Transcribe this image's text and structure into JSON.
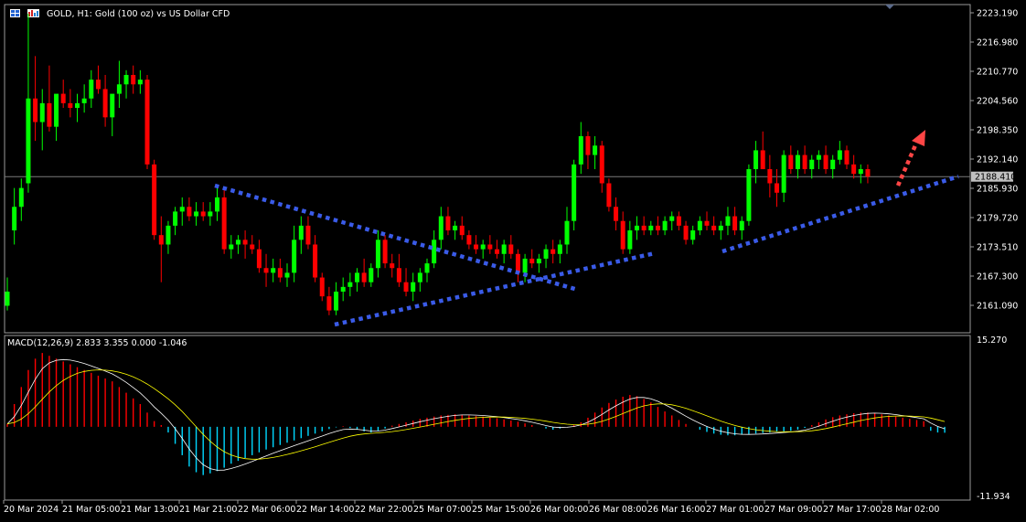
{
  "header": {
    "title": "GOLD, H1:  Gold (100 oz) vs US Dollar CFD",
    "icon": "window-tiles-icon"
  },
  "price_axis": {
    "labels": [
      "2223.190",
      "2216.980",
      "2210.770",
      "2204.560",
      "2198.350",
      "2192.140",
      "2185.930",
      "2179.720",
      "2173.510",
      "2167.300",
      "2161.090"
    ],
    "current_price": "2188.410"
  },
  "macd": {
    "label": "MACD(12,26,9) 2.833 3.355 0.000 -1.046",
    "axis_max": "15.270",
    "axis_min": "-11.934"
  },
  "time_axis": {
    "labels": [
      "20 Mar 2024",
      "21 Mar 05:00",
      "21 Mar 13:00",
      "21 Mar 21:00",
      "22 Mar 06:00",
      "22 Mar 14:00",
      "22 Mar 22:00",
      "25 Mar 07:00",
      "25 Mar 15:00",
      "26 Mar 00:00",
      "26 Mar 08:00",
      "26 Mar 16:00",
      "27 Mar 01:00",
      "27 Mar 09:00",
      "27 Mar 17:00",
      "28 Mar 02:00"
    ]
  },
  "colors": {
    "bull": "#00ff00",
    "bear": "#ff0000",
    "trend": "#3a5be8",
    "arrow": "#ff4040",
    "macd_pos": "#ff0000",
    "macd_neg": "#00d8ff",
    "macd_line": "#ffffff",
    "signal_line": "#ffff00"
  },
  "chart_data": {
    "type": "candlestick",
    "symbol": "GOLD",
    "timeframe": "H1",
    "y_range": [
      2157.3,
      2226.0
    ],
    "candles": [
      {
        "o": 2161,
        "h": 2167,
        "l": 2160,
        "c": 2164
      },
      {
        "o": 2177,
        "h": 2186,
        "l": 2174,
        "c": 2182
      },
      {
        "o": 2182,
        "h": 2188,
        "l": 2179,
        "c": 2186
      },
      {
        "o": 2187,
        "h": 2223,
        "l": 2185,
        "c": 2205
      },
      {
        "o": 2205,
        "h": 2214,
        "l": 2196,
        "c": 2200
      },
      {
        "o": 2200,
        "h": 2207,
        "l": 2194,
        "c": 2204
      },
      {
        "o": 2204,
        "h": 2212,
        "l": 2198,
        "c": 2199
      },
      {
        "o": 2199,
        "h": 2205,
        "l": 2196,
        "c": 2206
      },
      {
        "o": 2206,
        "h": 2209,
        "l": 2203,
        "c": 2204
      },
      {
        "o": 2204,
        "h": 2207,
        "l": 2201,
        "c": 2203
      },
      {
        "o": 2203,
        "h": 2206,
        "l": 2200,
        "c": 2204
      },
      {
        "o": 2204,
        "h": 2208,
        "l": 2202,
        "c": 2205
      },
      {
        "o": 2205,
        "h": 2211,
        "l": 2203,
        "c": 2209
      },
      {
        "o": 2209,
        "h": 2212,
        "l": 2206,
        "c": 2207
      },
      {
        "o": 2207,
        "h": 2210,
        "l": 2199,
        "c": 2201
      },
      {
        "o": 2201,
        "h": 2205,
        "l": 2197,
        "c": 2206
      },
      {
        "o": 2206,
        "h": 2213,
        "l": 2203,
        "c": 2208
      },
      {
        "o": 2208,
        "h": 2211,
        "l": 2205,
        "c": 2210
      },
      {
        "o": 2210,
        "h": 2212,
        "l": 2206,
        "c": 2208
      },
      {
        "o": 2208,
        "h": 2211,
        "l": 2206,
        "c": 2209
      },
      {
        "o": 2209,
        "h": 2210,
        "l": 2190,
        "c": 2191
      },
      {
        "o": 2191,
        "h": 2192,
        "l": 2175,
        "c": 2176
      },
      {
        "o": 2176,
        "h": 2180,
        "l": 2166,
        "c": 2174
      },
      {
        "o": 2174,
        "h": 2179,
        "l": 2172,
        "c": 2178
      },
      {
        "o": 2178,
        "h": 2182,
        "l": 2176,
        "c": 2181
      },
      {
        "o": 2181,
        "h": 2184,
        "l": 2178,
        "c": 2182
      },
      {
        "o": 2182,
        "h": 2184,
        "l": 2179,
        "c": 2180
      },
      {
        "o": 2180,
        "h": 2183,
        "l": 2178,
        "c": 2181
      },
      {
        "o": 2181,
        "h": 2183,
        "l": 2179,
        "c": 2180
      },
      {
        "o": 2180,
        "h": 2183,
        "l": 2178,
        "c": 2181
      },
      {
        "o": 2181,
        "h": 2186,
        "l": 2179,
        "c": 2184
      },
      {
        "o": 2184,
        "h": 2186,
        "l": 2172,
        "c": 2173
      },
      {
        "o": 2173,
        "h": 2176,
        "l": 2171,
        "c": 2174
      },
      {
        "o": 2174,
        "h": 2176,
        "l": 2172,
        "c": 2175
      },
      {
        "o": 2175,
        "h": 2177,
        "l": 2171,
        "c": 2174
      },
      {
        "o": 2174,
        "h": 2176,
        "l": 2172,
        "c": 2173
      },
      {
        "o": 2173,
        "h": 2175,
        "l": 2168,
        "c": 2169
      },
      {
        "o": 2169,
        "h": 2172,
        "l": 2165,
        "c": 2168
      },
      {
        "o": 2168,
        "h": 2171,
        "l": 2166,
        "c": 2169
      },
      {
        "o": 2169,
        "h": 2171,
        "l": 2166,
        "c": 2167
      },
      {
        "o": 2167,
        "h": 2170,
        "l": 2165,
        "c": 2168
      },
      {
        "o": 2168,
        "h": 2178,
        "l": 2166,
        "c": 2175
      },
      {
        "o": 2175,
        "h": 2180,
        "l": 2172,
        "c": 2178
      },
      {
        "o": 2178,
        "h": 2180,
        "l": 2173,
        "c": 2174
      },
      {
        "o": 2174,
        "h": 2176,
        "l": 2166,
        "c": 2167
      },
      {
        "o": 2167,
        "h": 2168,
        "l": 2162,
        "c": 2163
      },
      {
        "o": 2163,
        "h": 2165,
        "l": 2159,
        "c": 2160
      },
      {
        "o": 2160,
        "h": 2166,
        "l": 2159,
        "c": 2164
      },
      {
        "o": 2164,
        "h": 2167,
        "l": 2162,
        "c": 2165
      },
      {
        "o": 2165,
        "h": 2168,
        "l": 2163,
        "c": 2166
      },
      {
        "o": 2166,
        "h": 2169,
        "l": 2164,
        "c": 2168
      },
      {
        "o": 2168,
        "h": 2171,
        "l": 2165,
        "c": 2166
      },
      {
        "o": 2166,
        "h": 2170,
        "l": 2165,
        "c": 2169
      },
      {
        "o": 2169,
        "h": 2177,
        "l": 2167,
        "c": 2175
      },
      {
        "o": 2175,
        "h": 2176,
        "l": 2169,
        "c": 2170
      },
      {
        "o": 2170,
        "h": 2172,
        "l": 2167,
        "c": 2169
      },
      {
        "o": 2169,
        "h": 2172,
        "l": 2165,
        "c": 2166
      },
      {
        "o": 2166,
        "h": 2169,
        "l": 2163,
        "c": 2164
      },
      {
        "o": 2164,
        "h": 2168,
        "l": 2162,
        "c": 2166
      },
      {
        "o": 2166,
        "h": 2169,
        "l": 2164,
        "c": 2168
      },
      {
        "o": 2168,
        "h": 2171,
        "l": 2166,
        "c": 2170
      },
      {
        "o": 2170,
        "h": 2177,
        "l": 2169,
        "c": 2175
      },
      {
        "o": 2175,
        "h": 2182,
        "l": 2173,
        "c": 2180
      },
      {
        "o": 2180,
        "h": 2182,
        "l": 2176,
        "c": 2177
      },
      {
        "o": 2177,
        "h": 2179,
        "l": 2175,
        "c": 2178
      },
      {
        "o": 2178,
        "h": 2180,
        "l": 2175,
        "c": 2176
      },
      {
        "o": 2176,
        "h": 2177,
        "l": 2173,
        "c": 2174
      },
      {
        "o": 2174,
        "h": 2176,
        "l": 2172,
        "c": 2173
      },
      {
        "o": 2173,
        "h": 2175,
        "l": 2171,
        "c": 2174
      },
      {
        "o": 2174,
        "h": 2176,
        "l": 2172,
        "c": 2173
      },
      {
        "o": 2173,
        "h": 2175,
        "l": 2171,
        "c": 2172
      },
      {
        "o": 2172,
        "h": 2175,
        "l": 2170,
        "c": 2174
      },
      {
        "o": 2174,
        "h": 2176,
        "l": 2171,
        "c": 2172
      },
      {
        "o": 2172,
        "h": 2173,
        "l": 2166,
        "c": 2168
      },
      {
        "o": 2168,
        "h": 2172,
        "l": 2166,
        "c": 2171
      },
      {
        "o": 2171,
        "h": 2173,
        "l": 2169,
        "c": 2170
      },
      {
        "o": 2170,
        "h": 2172,
        "l": 2168,
        "c": 2171
      },
      {
        "o": 2171,
        "h": 2174,
        "l": 2169,
        "c": 2173
      },
      {
        "o": 2173,
        "h": 2175,
        "l": 2170,
        "c": 2172
      },
      {
        "o": 2172,
        "h": 2175,
        "l": 2170,
        "c": 2174
      },
      {
        "o": 2174,
        "h": 2182,
        "l": 2172,
        "c": 2179
      },
      {
        "o": 2179,
        "h": 2192,
        "l": 2177,
        "c": 2191
      },
      {
        "o": 2191,
        "h": 2200,
        "l": 2189,
        "c": 2197
      },
      {
        "o": 2197,
        "h": 2198,
        "l": 2190,
        "c": 2193
      },
      {
        "o": 2193,
        "h": 2197,
        "l": 2190,
        "c": 2195
      },
      {
        "o": 2195,
        "h": 2196,
        "l": 2185,
        "c": 2187
      },
      {
        "o": 2187,
        "h": 2188,
        "l": 2181,
        "c": 2182
      },
      {
        "o": 2182,
        "h": 2184,
        "l": 2177,
        "c": 2179
      },
      {
        "o": 2179,
        "h": 2181,
        "l": 2172,
        "c": 2173
      },
      {
        "o": 2173,
        "h": 2179,
        "l": 2172,
        "c": 2177
      },
      {
        "o": 2177,
        "h": 2180,
        "l": 2175,
        "c": 2178
      },
      {
        "o": 2178,
        "h": 2180,
        "l": 2176,
        "c": 2177
      },
      {
        "o": 2177,
        "h": 2179,
        "l": 2176,
        "c": 2178
      },
      {
        "o": 2178,
        "h": 2180,
        "l": 2176,
        "c": 2177
      },
      {
        "o": 2177,
        "h": 2180,
        "l": 2176,
        "c": 2179
      },
      {
        "o": 2179,
        "h": 2181,
        "l": 2177,
        "c": 2180
      },
      {
        "o": 2180,
        "h": 2181,
        "l": 2177,
        "c": 2178
      },
      {
        "o": 2178,
        "h": 2179,
        "l": 2174,
        "c": 2175
      },
      {
        "o": 2175,
        "h": 2178,
        "l": 2174,
        "c": 2177
      },
      {
        "o": 2177,
        "h": 2180,
        "l": 2176,
        "c": 2179
      },
      {
        "o": 2179,
        "h": 2181,
        "l": 2177,
        "c": 2178
      },
      {
        "o": 2178,
        "h": 2180,
        "l": 2176,
        "c": 2177
      },
      {
        "o": 2177,
        "h": 2179,
        "l": 2175,
        "c": 2178
      },
      {
        "o": 2178,
        "h": 2182,
        "l": 2176,
        "c": 2180
      },
      {
        "o": 2180,
        "h": 2182,
        "l": 2176,
        "c": 2177
      },
      {
        "o": 2177,
        "h": 2180,
        "l": 2175,
        "c": 2179
      },
      {
        "o": 2179,
        "h": 2191,
        "l": 2178,
        "c": 2190
      },
      {
        "o": 2190,
        "h": 2196,
        "l": 2187,
        "c": 2194
      },
      {
        "o": 2194,
        "h": 2198,
        "l": 2190,
        "c": 2190
      },
      {
        "o": 2190,
        "h": 2193,
        "l": 2184,
        "c": 2187
      },
      {
        "o": 2187,
        "h": 2190,
        "l": 2182,
        "c": 2185
      },
      {
        "o": 2185,
        "h": 2194,
        "l": 2183,
        "c": 2193
      },
      {
        "o": 2193,
        "h": 2195,
        "l": 2189,
        "c": 2190
      },
      {
        "o": 2190,
        "h": 2194,
        "l": 2188,
        "c": 2193
      },
      {
        "o": 2193,
        "h": 2195,
        "l": 2189,
        "c": 2190
      },
      {
        "o": 2190,
        "h": 2193,
        "l": 2188,
        "c": 2192
      },
      {
        "o": 2192,
        "h": 2194,
        "l": 2190,
        "c": 2193
      },
      {
        "o": 2193,
        "h": 2195,
        "l": 2189,
        "c": 2190
      },
      {
        "o": 2190,
        "h": 2193,
        "l": 2188,
        "c": 2192
      },
      {
        "o": 2192,
        "h": 2196,
        "l": 2191,
        "c": 2194
      },
      {
        "o": 2194,
        "h": 2195,
        "l": 2190,
        "c": 2191
      },
      {
        "o": 2191,
        "h": 2193,
        "l": 2188,
        "c": 2189
      },
      {
        "o": 2189,
        "h": 2191,
        "l": 2187,
        "c": 2190
      },
      {
        "o": 2190,
        "h": 2191,
        "l": 2187,
        "c": 2188.41
      }
    ],
    "macd_hist": [
      0.5,
      4,
      7,
      10,
      12,
      13,
      12.5,
      12,
      11.5,
      11,
      10.5,
      10,
      9.5,
      9,
      8.5,
      8,
      7,
      6,
      5,
      4,
      2.5,
      1,
      0.3,
      -1,
      -3,
      -5,
      -7,
      -8,
      -8.5,
      -8.2,
      -7.8,
      -7.2,
      -6.5,
      -6,
      -5.5,
      -5,
      -4.5,
      -4,
      -3.6,
      -3.2,
      -2.8,
      -2.4,
      -2,
      -1.6,
      -1.2,
      -0.8,
      -0.4,
      -0.1,
      0.1,
      -0.2,
      -0.5,
      -0.8,
      -1,
      -0.7,
      -0.3,
      0.2,
      0.5,
      0.8,
      1.1,
      1.4,
      1.6,
      1.8,
      2,
      2.1,
      2.2,
      2.1,
      2,
      1.9,
      1.8,
      1.6,
      1.5,
      1.3,
      1.1,
      0.9,
      0.6,
      0.3,
      0,
      -0.3,
      -0.5,
      -0.3,
      0,
      0.3,
      0.8,
      1.6,
      2.5,
      3.4,
      4.2,
      4.8,
      5.3,
      5.6,
      5.4,
      4.9,
      4.3,
      3.5,
      2.7,
      2,
      1.2,
      0.5,
      0,
      -0.5,
      -0.9,
      -1.2,
      -1.4,
      -1.5,
      -1.5,
      -1.4,
      -1.3,
      -1.2,
      -1.1,
      -1,
      -0.9,
      -0.8,
      -0.7,
      -0.5,
      -0.2,
      0.3,
      0.8,
      1.3,
      1.7,
      2,
      2.2,
      2.4,
      2.5,
      2.5,
      2.4,
      2.2,
      2,
      1.8,
      1.6,
      1.4,
      1.2,
      1,
      -0.7,
      -1,
      -1.046
    ],
    "macd_range": [
      -11.934,
      15.27
    ]
  }
}
